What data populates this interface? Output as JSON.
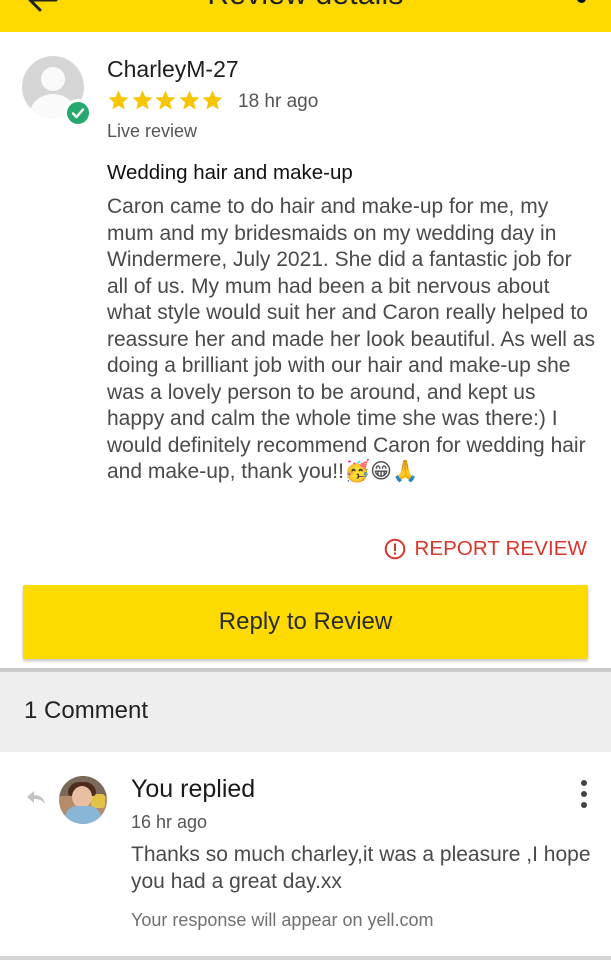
{
  "app_bar": {
    "title": "Review details",
    "back_icon": "arrow-back-icon",
    "menu_icon": "more-vert-icon",
    "background": "#fdd900"
  },
  "review": {
    "reviewer_name": "CharleyM-27",
    "avatar_icon": "default-user-avatar-icon",
    "verified_icon": "verified-check-icon",
    "rating": 5,
    "rating_max": 5,
    "time_ago": "18 hr ago",
    "status": "Live review",
    "title": "Wedding hair and make-up",
    "body": "Caron came to do hair and make-up for me, my mum and my bridesmaids on my wedding day in Windermere, July 2021.  She did a fantastic job for all of us.  My mum had been a bit nervous about what style would suit her and Caron really helped to reassure her and made her look beautiful.  As well as doing a brilliant job with our hair and make-up she was a lovely person to be around, and kept us happy and calm the whole time she was there:) I would definitely recommend Caron for wedding hair and make-up, thank you!!🥳😁🙏",
    "report_label": "REPORT REVIEW",
    "report_icon": "alert-circle-icon",
    "reply_button_label": "Reply to Review"
  },
  "comments": {
    "count_label": "1 Comment",
    "items": [
      {
        "author": "You replied",
        "time_ago": "16 hr ago",
        "text": "Thanks so much charley,it was a pleasure ,I hope you had a great day.xx",
        "note": "Your response will appear on yell.com",
        "reply_icon": "reply-arrow-icon",
        "menu_icon": "more-vert-icon"
      }
    ]
  },
  "colors": {
    "brand_yellow": "#fddb00",
    "star_yellow": "#f7c600",
    "report_red": "#d9352a",
    "verified_green": "#27a86c"
  }
}
